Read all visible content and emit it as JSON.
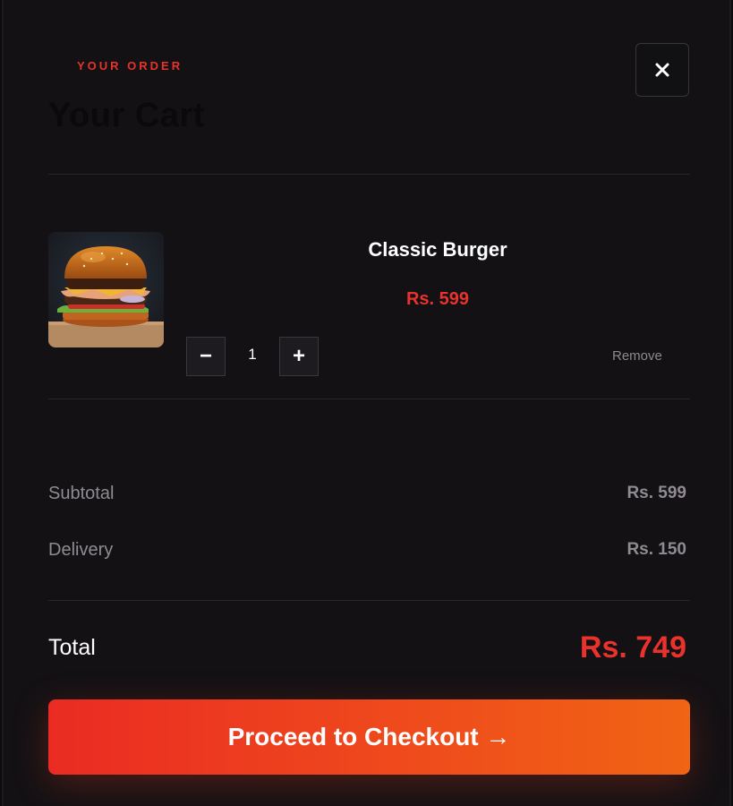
{
  "cart": {
    "eyebrow": "YOUR ORDER",
    "title": "Your Cart",
    "close_icon": "close-icon"
  },
  "items": [
    {
      "name": "Classic Burger",
      "price": "Rs. 599",
      "quantity": "1",
      "decrement_label": "−",
      "increment_label": "+",
      "remove_label": "Remove",
      "image_icon": "burger-image"
    }
  ],
  "summary": {
    "subtotal_label": "Subtotal",
    "subtotal_value": "Rs. 599",
    "delivery_label": "Delivery",
    "delivery_value": "Rs. 150",
    "total_label": "Total",
    "total_value": "Rs. 749"
  },
  "checkout": {
    "label": "Proceed to Checkout →"
  },
  "colors": {
    "accent": "#e8322b",
    "background": "#131114",
    "button_gradient_start": "#ea2b23",
    "button_gradient_end": "#f06414"
  }
}
